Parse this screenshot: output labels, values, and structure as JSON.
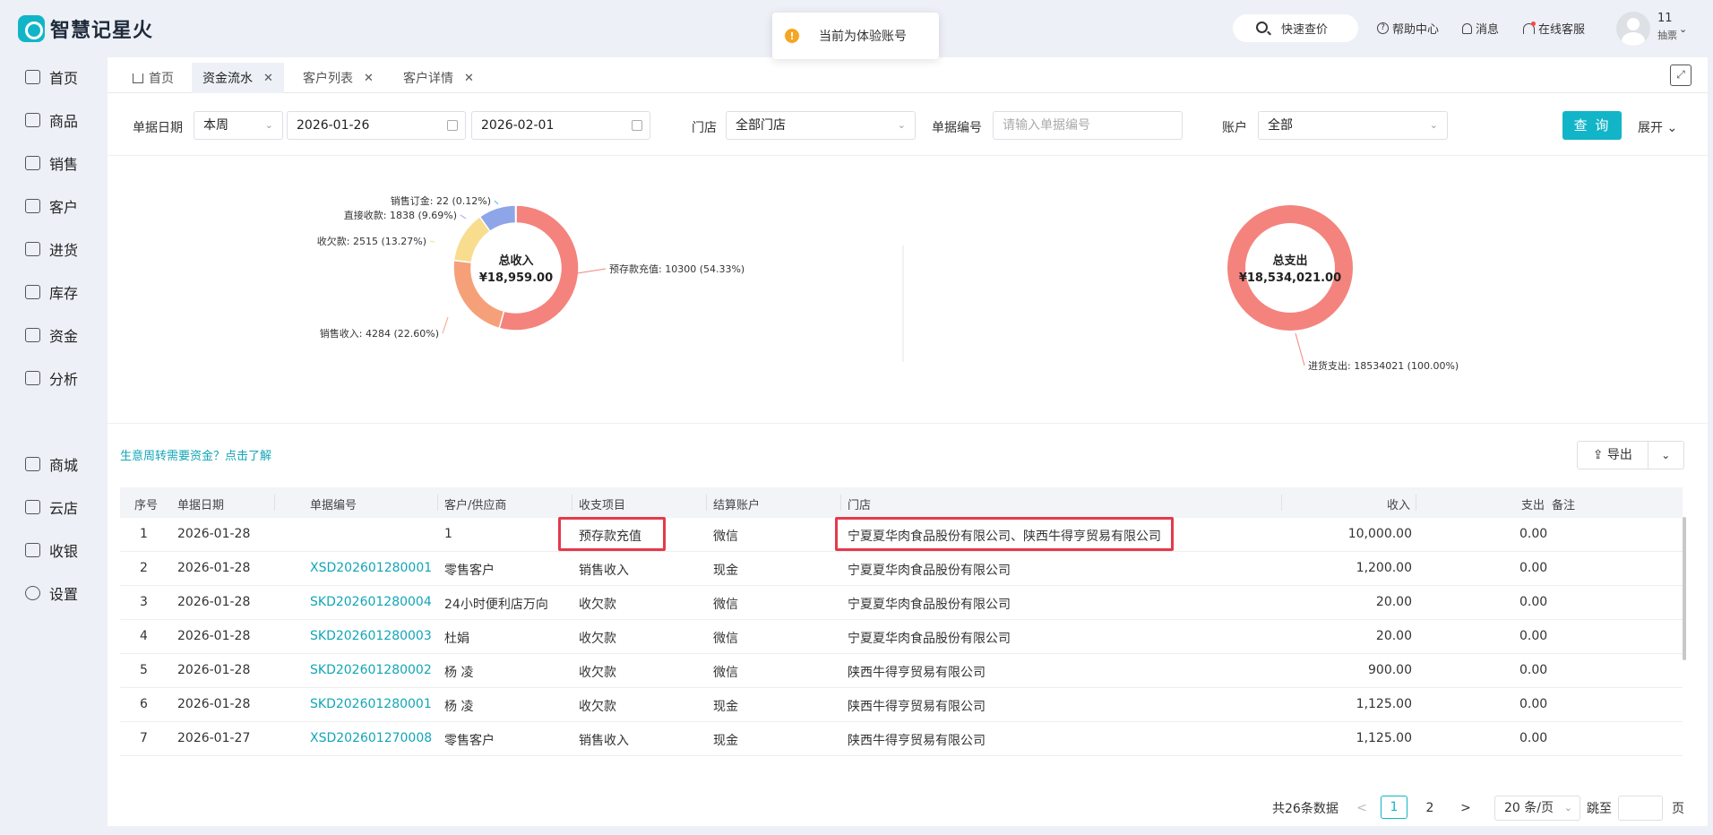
{
  "app": {
    "name": "智慧记星火"
  },
  "toast": {
    "text": "当前为体验账号",
    "icon": "!"
  },
  "header": {
    "search_label": "快速查价",
    "help_label": "帮助中心",
    "messages_label": "消息",
    "service_label": "在线客服",
    "user_name": "11",
    "user_sub": "抽票"
  },
  "sidebar": {
    "items": [
      {
        "label": "首页",
        "icon": "home-icon"
      },
      {
        "label": "商品",
        "icon": "goods-icon"
      },
      {
        "label": "销售",
        "icon": "sales-icon"
      },
      {
        "label": "客户",
        "icon": "customer-icon"
      },
      {
        "label": "进货",
        "icon": "purchase-icon"
      },
      {
        "label": "库存",
        "icon": "inventory-icon"
      },
      {
        "label": "资金",
        "icon": "funds-icon"
      },
      {
        "label": "分析",
        "icon": "analysis-icon"
      }
    ],
    "items2": [
      {
        "label": "商城",
        "icon": "mall-icon"
      },
      {
        "label": "云店",
        "icon": "cloud-store-icon"
      },
      {
        "label": "收银",
        "icon": "cashier-icon"
      },
      {
        "label": "设置",
        "icon": "settings-icon"
      }
    ]
  },
  "tabs": [
    {
      "label": "首页"
    },
    {
      "label": "资金流水"
    },
    {
      "label": "客户列表"
    },
    {
      "label": "客户详情"
    }
  ],
  "filters": {
    "date_label": "单据日期",
    "period_value": "本周",
    "start_date": "2026-01-26",
    "end_date": "2026-02-01",
    "store_label": "门店",
    "store_value": "全部门店",
    "doc_no_label": "单据编号",
    "doc_no_placeholder": "请输入单据编号",
    "account_label": "账户",
    "account_value": "全部",
    "query_label": "查 询",
    "unfold_label": "展开"
  },
  "chart_data": [
    {
      "type": "pie",
      "title": "总收入",
      "total_label": "¥18,959.00",
      "slices": [
        {
          "name": "预存款充值",
          "value": 10300,
          "percent": 54.33,
          "color": "#f4837d",
          "label": "预存款充值: 10300 (54.33%)"
        },
        {
          "name": "销售收入",
          "value": 4284,
          "percent": 22.6,
          "color": "#f6a07a",
          "label": "销售收入: 4284 (22.60%)"
        },
        {
          "name": "收欠款",
          "value": 2515,
          "percent": 13.27,
          "color": "#f8dd8e",
          "label": "收欠款: 2515 (13.27%)"
        },
        {
          "name": "直接收款",
          "value": 1838,
          "percent": 9.69,
          "color": "#8ea5e8",
          "label": "直接收款: 1838 (9.69%)"
        },
        {
          "name": "销售订金",
          "value": 22,
          "percent": 0.12,
          "color": "#4db9e8",
          "label": "销售订金: 22 (0.12%)"
        }
      ]
    },
    {
      "type": "pie",
      "title": "总支出",
      "total_label": "¥18,534,021.00",
      "slices": [
        {
          "name": "进货支出",
          "value": 18534021,
          "percent": 100.0,
          "color": "#f4837d",
          "label": "进货支出: 18534021 (100.00%)"
        }
      ]
    }
  ],
  "promo": {
    "text": "生意周转需要资金？点击了解"
  },
  "export": {
    "label": "导出"
  },
  "table": {
    "headers": [
      "序号",
      "单据日期",
      "单据编号",
      "客户/供应商",
      "收支项目",
      "结算账户",
      "门店",
      "收入",
      "支出",
      "备注"
    ],
    "rows": [
      {
        "no": "1",
        "date": "2026-01-28",
        "doc": "",
        "party": "1",
        "item": "预存款充值",
        "account": "微信",
        "store": "宁夏夏华肉食品股份有限公司、陕西牛得亨贸易有限公司",
        "income": "10,000.00",
        "expense": "0.00"
      },
      {
        "no": "2",
        "date": "2026-01-28",
        "doc": "XSD202601280001",
        "party": "零售客户",
        "item": "销售收入",
        "account": "现金",
        "store": "宁夏夏华肉食品股份有限公司",
        "income": "1,200.00",
        "expense": "0.00"
      },
      {
        "no": "3",
        "date": "2026-01-28",
        "doc": "SKD202601280004",
        "party": "24小时便利店万向",
        "item": "收欠款",
        "account": "微信",
        "store": "宁夏夏华肉食品股份有限公司",
        "income": "20.00",
        "expense": "0.00"
      },
      {
        "no": "4",
        "date": "2026-01-28",
        "doc": "SKD202601280003",
        "party": "杜娟",
        "item": "收欠款",
        "account": "微信",
        "store": "宁夏夏华肉食品股份有限公司",
        "income": "20.00",
        "expense": "0.00"
      },
      {
        "no": "5",
        "date": "2026-01-28",
        "doc": "SKD202601280002",
        "party": "杨 凌",
        "item": "收欠款",
        "account": "微信",
        "store": "陕西牛得亨贸易有限公司",
        "income": "900.00",
        "expense": "0.00"
      },
      {
        "no": "6",
        "date": "2026-01-28",
        "doc": "SKD202601280001",
        "party": "杨 凌",
        "item": "收欠款",
        "account": "现金",
        "store": "陕西牛得亨贸易有限公司",
        "income": "1,125.00",
        "expense": "0.00"
      },
      {
        "no": "7",
        "date": "2026-01-27",
        "doc": "XSD202601270008",
        "party": "零售客户",
        "item": "销售收入",
        "account": "现金",
        "store": "陕西牛得亨贸易有限公司",
        "income": "1,125.00",
        "expense": "0.00"
      }
    ]
  },
  "pagination": {
    "total_text": "共26条数据",
    "prev": "<",
    "pages": [
      "1",
      "2"
    ],
    "next": ">",
    "page_size": "20 条/页",
    "jump_label": "跳至",
    "page_suffix": "页"
  }
}
